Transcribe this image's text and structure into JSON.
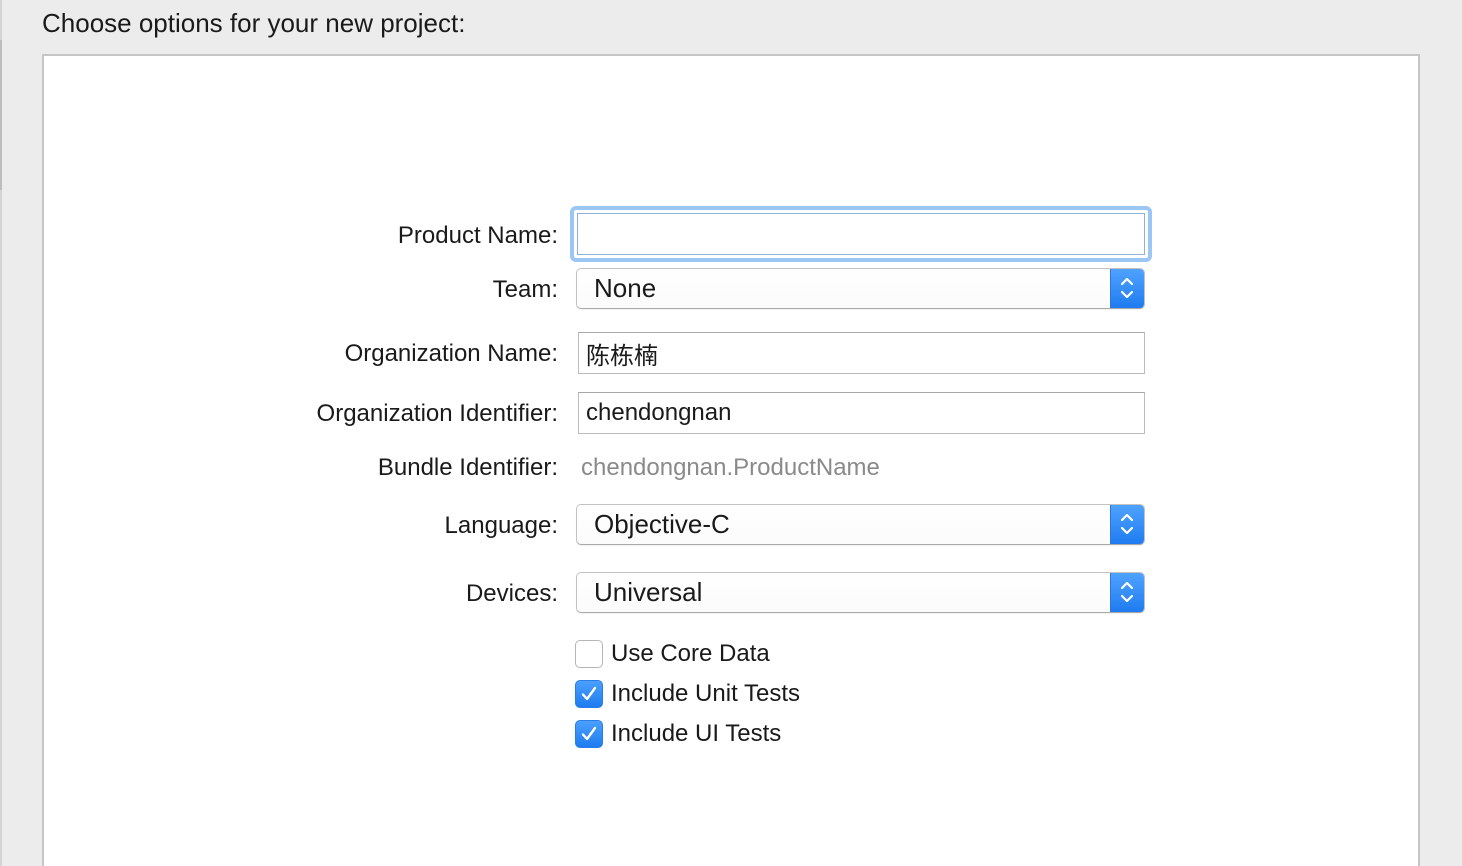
{
  "header": {
    "title": "Choose options for your new project:"
  },
  "form": {
    "product_name": {
      "label": "Product Name:",
      "value": ""
    },
    "team": {
      "label": "Team:",
      "value": "None"
    },
    "organization_name": {
      "label": "Organization Name:",
      "value": "陈栋楠"
    },
    "organization_identifier": {
      "label": "Organization Identifier:",
      "value": "chendongnan"
    },
    "bundle_identifier": {
      "label": "Bundle Identifier:",
      "value": "chendongnan.ProductName"
    },
    "language": {
      "label": "Language:",
      "value": "Objective-C"
    },
    "devices": {
      "label": "Devices:",
      "value": "Universal"
    },
    "checkboxes": [
      {
        "label": "Use Core Data",
        "checked": false
      },
      {
        "label": "Include Unit Tests",
        "checked": true
      },
      {
        "label": "Include UI Tests",
        "checked": true
      }
    ]
  },
  "colors": {
    "accent": "#1f7cf0",
    "focus_ring": "#9cc7f5",
    "window_bg": "#ececec",
    "panel_bg": "#ffffff",
    "secondary_text": "#8a8a8a"
  },
  "icons": {
    "popup_stepper": "up-down-chevron-icon",
    "checkmark": "checkmark-icon"
  }
}
